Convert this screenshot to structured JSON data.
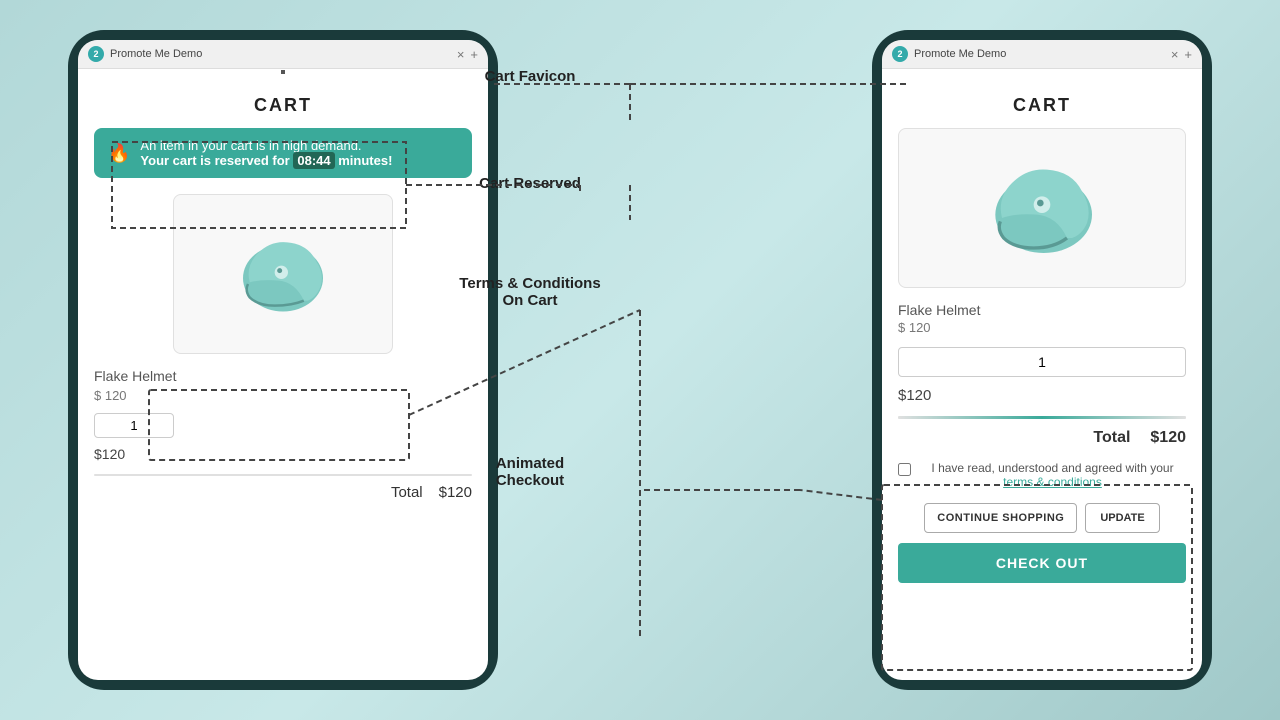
{
  "page": {
    "background": "teal gradient",
    "annotations": {
      "cart_favicon": "Cart Favicon",
      "cart_reserved": "Cart Reserved",
      "terms_conditions": "Terms & Conditions\nOn Cart",
      "animated_checkout": "Animated\nCheckout"
    }
  },
  "left_phone": {
    "browser": {
      "favicon_number": "2",
      "tab_title": "Promote Me Demo",
      "close_label": "×",
      "plus_label": "+"
    },
    "cart": {
      "title": "CART",
      "alert": {
        "text1": "An item in your cart is in high demand.",
        "text2": "Your cart is reserved for",
        "timer": "08:44",
        "text3": "minutes!"
      },
      "product": {
        "name": "Flake Helmet",
        "price_label": "$ 120",
        "quantity": "1",
        "total": "$120"
      },
      "total_label": "Total",
      "total_value": "$120"
    }
  },
  "right_phone": {
    "browser": {
      "favicon_number": "2",
      "tab_title": "Promote Me Demo",
      "close_label": "×",
      "plus_label": "+"
    },
    "cart": {
      "title": "CART",
      "product": {
        "name": "Flake Helmet",
        "price_label": "$ 120",
        "quantity": "1",
        "total": "$120"
      },
      "total_label": "Total",
      "total_value": "$120",
      "terms_text1": "I have read, understood and agreed with your",
      "terms_link": "terms & conditions",
      "continue_button": "CONTINUE SHOPPING",
      "update_button": "UPDATE",
      "checkout_button": "CHECK OUT"
    }
  }
}
